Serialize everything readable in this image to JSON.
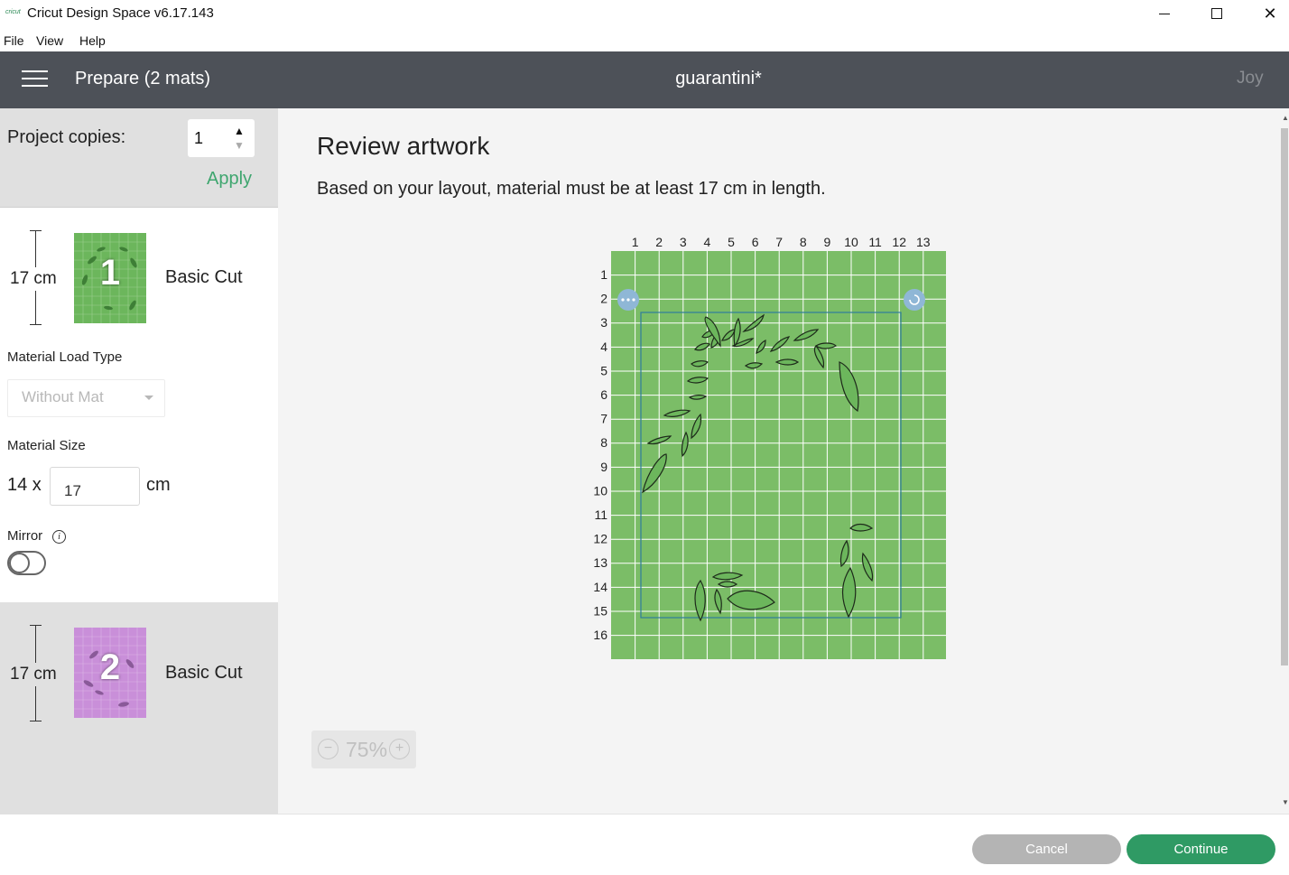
{
  "window": {
    "logo": "cricut",
    "title": "Cricut Design Space  v6.17.143",
    "controls": [
      "minimize-icon",
      "maximize-icon",
      "close-icon"
    ]
  },
  "menu": {
    "file": "File",
    "view": "View",
    "help": "Help"
  },
  "header": {
    "prepare": "Prepare (2 mats)",
    "project_name": "guarantini*",
    "machine": "Joy"
  },
  "copies": {
    "label": "Project copies:",
    "value": "1",
    "apply": "Apply"
  },
  "mats": [
    {
      "length": "17 cm",
      "number": "1",
      "name": "Basic Cut",
      "color": "#6cb65c"
    },
    {
      "length": "17 cm",
      "number": "2",
      "name": "Basic Cut",
      "color": "#c98fd9"
    }
  ],
  "material_load": {
    "label": "Material Load Type",
    "value": "Without Mat"
  },
  "material_size": {
    "label": "Material Size",
    "width": "14 x",
    "length": "17",
    "unit": "cm"
  },
  "mirror": {
    "label": "Mirror",
    "info": "i",
    "enabled": false
  },
  "main": {
    "title": "Review artwork",
    "subtitle": "Based on your layout, material must be at least 17 cm in length."
  },
  "mat_preview": {
    "columns": [
      "1",
      "2",
      "3",
      "4",
      "5",
      "6",
      "7",
      "8",
      "9",
      "10",
      "11",
      "12",
      "13"
    ],
    "rows": [
      "1",
      "2",
      "3",
      "4",
      "5",
      "6",
      "7",
      "8",
      "9",
      "10",
      "11",
      "12",
      "13",
      "14",
      "15",
      "16"
    ],
    "mat_color": "#7bbd67",
    "grid_color": "#ffffff",
    "handle_color": "#8fb7d6"
  },
  "zoom": {
    "minus": "−",
    "value": "75%",
    "plus": "+"
  },
  "footer": {
    "cancel": "Cancel",
    "continue": "Continue"
  }
}
